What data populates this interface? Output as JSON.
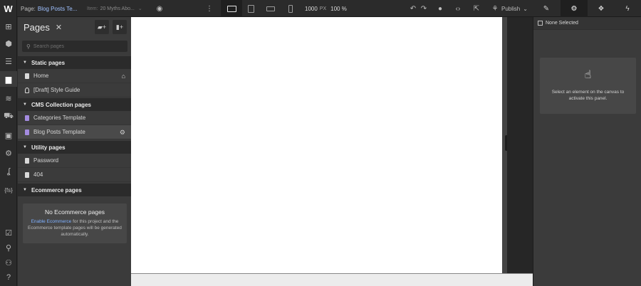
{
  "topbar": {
    "logo": "W",
    "page_prefix": "Page:",
    "page_name": "Blog Posts Te...",
    "item_prefix": "Item:",
    "item_name": "20 Myths Abo...",
    "width_value": "1000",
    "width_unit": "PX",
    "zoom": "100 %",
    "publish_label": "Publish"
  },
  "pages_panel": {
    "title": "Pages",
    "search_placeholder": "Search pages",
    "sections": [
      {
        "label": "Static pages",
        "items": [
          {
            "label": "Home"
          },
          {
            "label": "[Draft] Style Guide"
          }
        ]
      },
      {
        "label": "CMS Collection pages",
        "items": [
          {
            "label": "Categories Template"
          },
          {
            "label": "Blog Posts Template"
          }
        ]
      },
      {
        "label": "Utility pages",
        "items": [
          {
            "label": "Password"
          },
          {
            "label": "404"
          }
        ]
      },
      {
        "label": "Ecommerce pages",
        "items": []
      }
    ],
    "ecommerce_card": {
      "title": "No Ecommerce pages",
      "link_text": "Enable Ecommerce",
      "desc_rest": " for this project and the Ecommerce template pages will be generated automatically."
    }
  },
  "right_panel": {
    "selection_label": "None Selected",
    "empty_message": "Select an element on the canvas to activate this panel."
  },
  "colors": {
    "accent": "#9fc1ff",
    "cms_icon": "#a48be0",
    "panel_bg": "#3b3b3b",
    "section_bg": "#2b2b2b"
  }
}
